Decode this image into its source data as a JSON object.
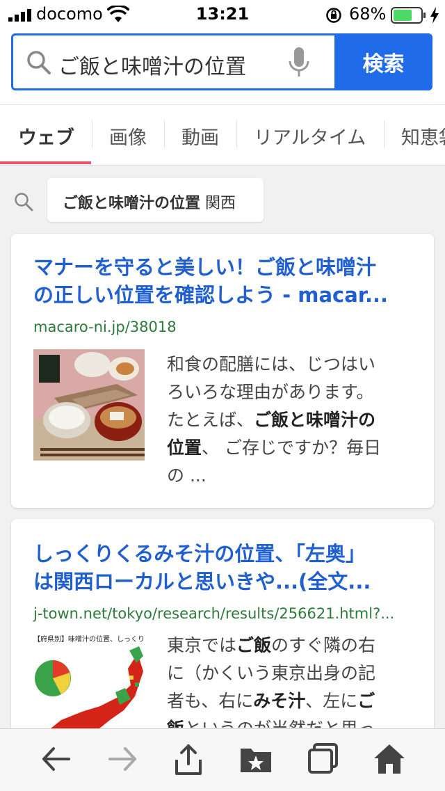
{
  "status_bar": {
    "carrier": "docomo",
    "time": "13:21",
    "battery": "68%"
  },
  "search": {
    "query": "ご飯と味噌汁の位置",
    "button_label": "検索"
  },
  "tabs": [
    {
      "label": "ウェブ",
      "active": true
    },
    {
      "label": "画像",
      "active": false
    },
    {
      "label": "動画",
      "active": false
    },
    {
      "label": "リアルタイム",
      "active": false
    },
    {
      "label": "知恵袋",
      "active": false
    }
  ],
  "related": {
    "bold": "ご飯と味噌汁の位置",
    "rest": "関西"
  },
  "results": [
    {
      "title_line1": "マナーを守ると美しい！ご飯と味噌汁",
      "title_line2": "の正しい位置を確認しよう - macar...",
      "url": "macaro-ni.jp/38018",
      "snippet": {
        "p1": "和食の配膳には、じつはい",
        "p2": "ろいろな理由があります。",
        "p3": "たとえば、",
        "b1": "ご飯と味噌汁の",
        "b2": "位置",
        "p4": "、 ご存じですか？毎日",
        "p5": "の ..."
      }
    },
    {
      "title_line1": "しっくりくるみそ汁の位置、「左奥」",
      "title_line2": "は関西ローカルと思いきや...(全文...",
      "url": "j-town.net/tokyo/research/results/256621.html?...",
      "thumb_caption": "【府県別】味噌汁の位置、しっくりくる",
      "snippet": {
        "p1": "東京では",
        "b1": "ご飯",
        "p2": "のすぐ隣の右",
        "p3": "に（かくいう東京出身の記",
        "p4": "者も、右に",
        "b2": "みそ汁",
        "p5": "、左に",
        "b3": "ご",
        "b4": "飯",
        "p6": "というのが当然だと思っ"
      }
    }
  ],
  "colors": {
    "accent": "#1f6bea",
    "title_link": "#1f5fcf",
    "url_green": "#2c7a3a",
    "tab_underline": "#e95464",
    "battery_green": "#4cd964"
  }
}
